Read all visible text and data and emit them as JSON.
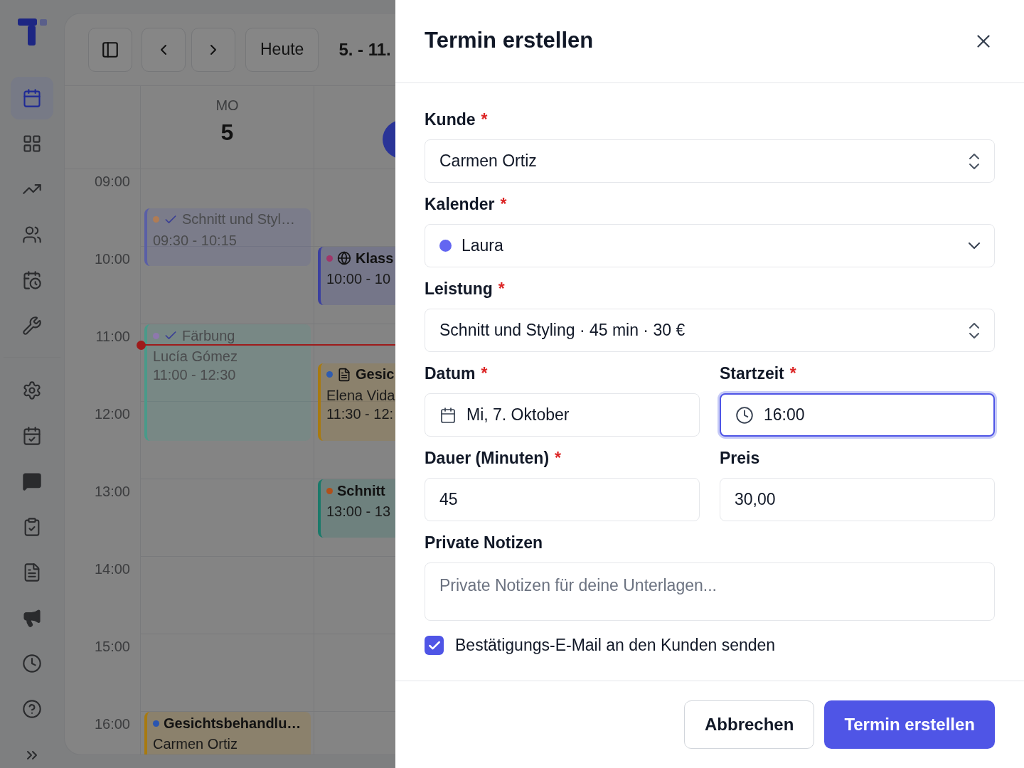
{
  "sidebar": {
    "groups": [
      {
        "items": [
          {
            "selected": true
          },
          {
            "selected": false
          },
          {
            "selected": false
          },
          {
            "selected": false
          },
          {
            "selected": false
          },
          {
            "selected": false
          }
        ]
      },
      {
        "items": [
          {
            "selected": false
          },
          {
            "selected": false
          },
          {
            "selected": false
          },
          {
            "selected": false
          },
          {
            "selected": false
          },
          {
            "selected": false
          },
          {
            "selected": false
          },
          {
            "selected": false
          }
        ]
      }
    ]
  },
  "toolbar": {
    "today_button": "Heute",
    "range": "5. - 11."
  },
  "days": [
    {
      "weekday": "MO",
      "date": "5",
      "events": [
        {
          "kind": "done",
          "title": "Schnitt und Styl…",
          "time": "09:30 - 10:15",
          "color": "#b07c55",
          "calendar": {
            "color": "#5a5fa6"
          }
        },
        {
          "kind": "done",
          "title": "Färbung",
          "customer": "Lucía Gómez",
          "time": "11:00 - 12:30",
          "color": "#8e78ad",
          "calendar": {
            "color": "#4a9a8a"
          }
        },
        {
          "kind": "plain",
          "title": "Gesichtsbehandlu…",
          "customer": "Carmen Ortiz",
          "color": "#2a55b0",
          "calendar": {
            "color": "#a87a10"
          }
        }
      ]
    },
    {
      "today": true,
      "events": [
        {
          "kind": "online",
          "title": "Klass",
          "time": "10:00 - 10",
          "color": "#a0366a",
          "calendar": {
            "color": "#3a3fa0"
          }
        },
        {
          "kind": "form",
          "title": "Gesic",
          "customer": "Elena Vida",
          "time": "11:30 - 12:",
          "color": "#2f5cb0",
          "calendar": {
            "color": "#a87a10"
          }
        },
        {
          "kind": "plain",
          "title": "Schnitt",
          "time": "13:00 - 13",
          "color": "#b0501a",
          "calendar": {
            "color": "#1a7a6a"
          }
        }
      ]
    }
  ],
  "hours": [
    "09:00",
    "10:00",
    "11:00",
    "12:00",
    "13:00",
    "14:00",
    "15:00",
    "16:00"
  ],
  "drawer": {
    "title": "Termin erstellen",
    "rows": [
      {
        "fields": [
          {
            "label": "Kunde",
            "required_mark": "*",
            "kind": "combobox",
            "value": "Carmen Ortiz",
            "focused": false
          }
        ]
      },
      {
        "fields": [
          {
            "label": "Kalender",
            "required_mark": "*",
            "kind": "select",
            "value": "Laura",
            "color": "#6366f1",
            "focused": false
          }
        ]
      },
      {
        "fields": [
          {
            "label": "Leistung",
            "required_mark": "*",
            "kind": "combobox",
            "value": "Schnitt und Styling · 45 min · 30 €",
            "focused": false
          }
        ]
      },
      {
        "fields": [
          {
            "label": "Datum",
            "required_mark": "*",
            "kind": "date",
            "value": "Mi, 7. Oktober",
            "focused": false
          },
          {
            "label": "Startzeit",
            "required_mark": "*",
            "kind": "time",
            "value": "16:00",
            "focused": true
          }
        ]
      },
      {
        "fields": [
          {
            "label": "Dauer (Minuten)",
            "required_mark": "*",
            "kind": "text",
            "value": "45",
            "focused": false
          },
          {
            "label": "Preis",
            "kind": "text",
            "value": "30,00",
            "focused": false
          }
        ]
      },
      {
        "fields": [
          {
            "label": "Private Notizen",
            "kind": "textarea",
            "placeholder": "Private Notizen für deine Unterlagen...",
            "focused": false
          }
        ]
      }
    ],
    "checkbox": {
      "label": "Bestätigungs-E-Mail an den Kunden senden",
      "checked": true
    },
    "buttons": [
      {
        "label": "Abbrechen",
        "kind": "secondary"
      },
      {
        "label": "Termin erstellen",
        "kind": "primary"
      }
    ]
  }
}
